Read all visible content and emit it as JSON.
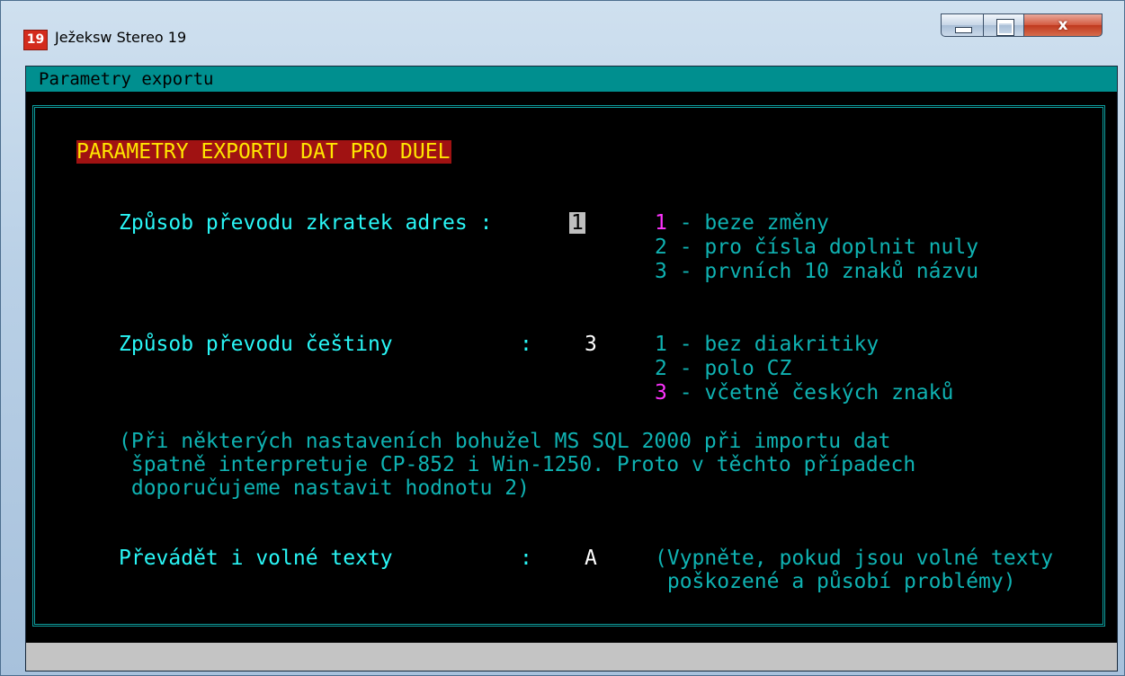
{
  "window": {
    "icon_text": "19",
    "title": "Ježeksw Stereo 19",
    "close_glyph": "x"
  },
  "menubar": {
    "title": "Parametry exportu"
  },
  "form": {
    "heading": "PARAMETRY EXPORTU DAT PRO DUEL",
    "fields": [
      {
        "label": "Způsob převodu zkratek adres :",
        "value": "1",
        "options": [
          {
            "num": "1",
            "text": " - beze změny",
            "selected": true
          },
          {
            "num": "2",
            "text": " - pro čísla doplnit nuly",
            "selected": false
          },
          {
            "num": "3",
            "text": " - prvních 10 znaků názvu",
            "selected": false
          }
        ]
      },
      {
        "label": "Způsob převodu češtiny",
        "colon": ":",
        "value": "3",
        "options": [
          {
            "num": "1",
            "text": " - bez diakritiky",
            "selected": false
          },
          {
            "num": "2",
            "text": " - polo CZ",
            "selected": false
          },
          {
            "num": "3",
            "text": " - včetně českých znaků",
            "selected": true
          }
        ]
      },
      {
        "label": "Převádět i volné texty",
        "colon": ":",
        "value": "A",
        "hint": [
          "(Vypněte, pokud jsou volné texty",
          " poškozené a působí problémy)"
        ]
      }
    ],
    "note": [
      "(Při některých nastaveních bohužel MS SQL 2000 při importu dat",
      " špatně interpretuje CP-852 i Win-1250. Proto v těchto případech",
      " doporučujeme nastavit hodnotu 2)"
    ]
  },
  "colors": {
    "label": "#29f6f6",
    "option": "#0fb2b2",
    "selected_option": "#ff33ff",
    "heading_text": "#ffe600",
    "heading_bg": "#a01212",
    "menubar": "#008f8f"
  }
}
